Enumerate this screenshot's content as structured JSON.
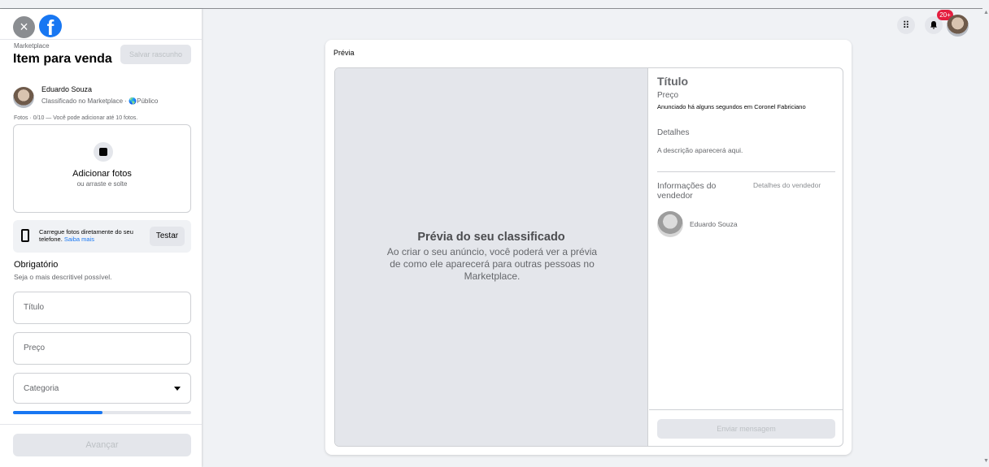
{
  "header": {
    "close_icon": "×",
    "logo_letter": "f"
  },
  "form": {
    "breadcrumb": "Marketplace",
    "title": "Item para venda",
    "save_draft": "Salvar rascunho",
    "user_name": "Eduardo Souza",
    "user_sub": "Classificado no Marketplace · 🌎Público",
    "photo_hint": "Fotos · 0/10 — Você pode adicionar até 10 fotos.",
    "photo_label": "Adicionar fotos",
    "photo_sub": "ou arraste e solte",
    "phone_text": "Carregue fotos diretamente do seu telefone.",
    "phone_link": "Saiba mais",
    "test_button": "Testar",
    "required_title": "Obrigatório",
    "required_sub": "Seja o mais descritivel possível.",
    "title_placeholder": "Título",
    "price_placeholder": "Preço",
    "category_placeholder": "Categoria",
    "progress_fraction": 0.5,
    "next_button": "Avançar"
  },
  "topbar": {
    "menu_icon": "⠿",
    "notifications_badge": "20+"
  },
  "preview": {
    "label": "Prévia",
    "placeholder_title": "Prévia do seu classificado",
    "placeholder_text": "Ao criar o seu anúncio, você poderá ver a prévia de como ele aparecerá para outras pessoas no Marketplace.",
    "item_title": "Título",
    "item_price": "Preço",
    "listed_text": "Anunciado há alguns segundos em Coronel Fabriciano",
    "details_heading": "Detalhes",
    "description": "A descrição aparecerá aqui.",
    "seller_heading": "Informações do vendedor",
    "seller_details_link": "Detalhes do vendedor",
    "seller_name": "Eduardo Souza",
    "send_message": "Enviar mensagem"
  },
  "colors": {
    "brand": "#1877f2",
    "badge": "#e41e3f"
  }
}
